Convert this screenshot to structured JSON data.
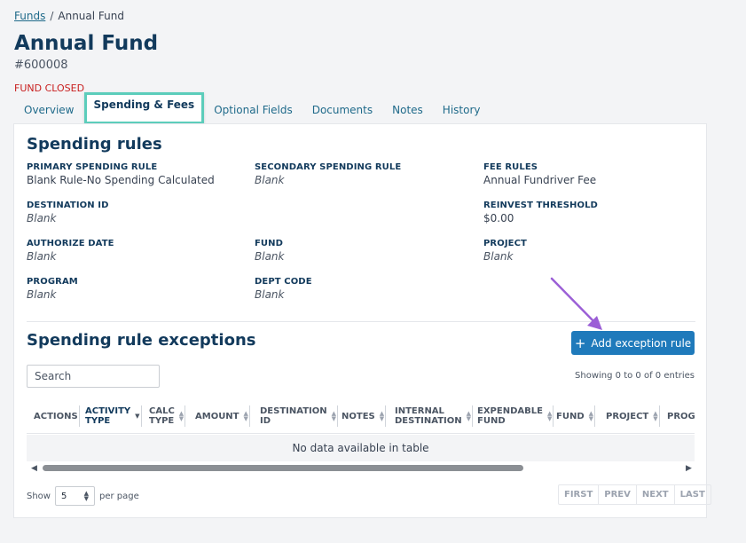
{
  "breadcrumb": {
    "root": "Funds",
    "separator": "/",
    "current": "Annual Fund"
  },
  "header": {
    "title": "Annual Fund",
    "id": "#600008",
    "status": "FUND CLOSED"
  },
  "tabs": [
    {
      "label": "Overview"
    },
    {
      "label": "Spending & Fees"
    },
    {
      "label": "Optional Fields"
    },
    {
      "label": "Documents"
    },
    {
      "label": "Notes"
    },
    {
      "label": "History"
    }
  ],
  "spending_rules": {
    "title": "Spending rules",
    "fields": {
      "primary": {
        "label": "PRIMARY SPENDING RULE",
        "value": "Blank Rule-No Spending Calculated"
      },
      "secondary": {
        "label": "SECONDARY SPENDING RULE",
        "value": "Blank"
      },
      "fee_rules": {
        "label": "FEE RULES",
        "value": "Annual Fundriver Fee"
      },
      "destination_id": {
        "label": "DESTINATION ID",
        "value": "Blank"
      },
      "reinvest": {
        "label": "REINVEST THRESHOLD",
        "value": "$0.00"
      },
      "authorize_date": {
        "label": "AUTHORIZE DATE",
        "value": "Blank"
      },
      "fund": {
        "label": "FUND",
        "value": "Blank"
      },
      "project": {
        "label": "PROJECT",
        "value": "Blank"
      },
      "program": {
        "label": "PROGRAM",
        "value": "Blank"
      },
      "dept_code": {
        "label": "DEPT CODE",
        "value": "Blank"
      }
    }
  },
  "exceptions": {
    "title": "Spending rule exceptions",
    "add_button": "Add exception rule",
    "search_placeholder": "Search",
    "showing": "Showing 0 to 0 of 0 entries",
    "columns": [
      {
        "line1": "ACTIONS",
        "line2": ""
      },
      {
        "line1": "ACTIVITY",
        "line2": "TYPE"
      },
      {
        "line1": "CALC",
        "line2": "TYPE"
      },
      {
        "line1": "AMOUNT",
        "line2": ""
      },
      {
        "line1": "DESTINATION",
        "line2": "ID"
      },
      {
        "line1": "NOTES",
        "line2": ""
      },
      {
        "line1": "INTERNAL",
        "line2": "DESTINATION"
      },
      {
        "line1": "EXPENDABLE",
        "line2": "FUND"
      },
      {
        "line1": "FUND",
        "line2": ""
      },
      {
        "line1": "PROJECT",
        "line2": ""
      },
      {
        "line1": "PROGR",
        "line2": ""
      }
    ],
    "empty_message": "No data available in table",
    "per_page_label_before": "Show",
    "per_page_value": "5",
    "per_page_label_after": "per page",
    "pager": {
      "first": "FIRST",
      "prev": "PREV",
      "next": "NEXT",
      "last": "LAST"
    }
  },
  "colors": {
    "accent": "#1f7abb",
    "title": "#123a5c",
    "status": "#c81e1e",
    "active_tab_border": "#5ccdbb",
    "annotation_arrow": "#9b5fd6"
  },
  "icons": {
    "add": "plus-icon",
    "annotation": "arrow-annotation"
  }
}
